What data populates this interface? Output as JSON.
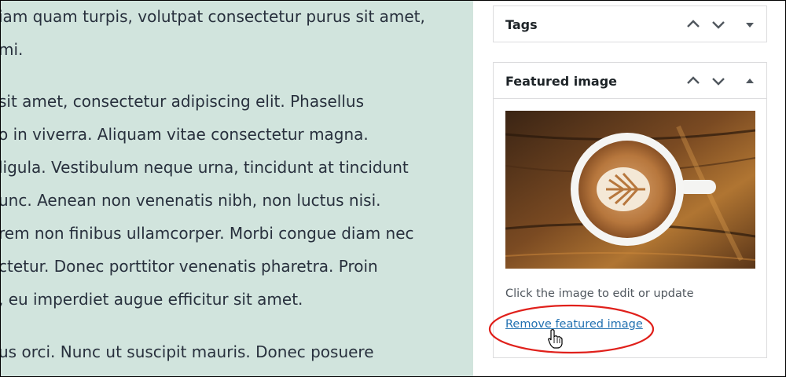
{
  "content": {
    "paragraphs": [
      {
        "lines": [
          "iam quam turpis, volutpat consectetur purus sit amet,",
          "mi."
        ]
      },
      {
        "lines": [
          "sit amet, consectetur adipiscing elit. Phasellus",
          "o in viverra. Aliquam vitae consectetur magna.",
          "ligula. Vestibulum neque urna, tincidunt at tincidunt",
          "unc. Aenean non venenatis nibh, non luctus nisi.",
          "rem non finibus ullamcorper. Morbi congue diam nec",
          "ctetur. Donec porttitor venenatis pharetra. Proin",
          ", eu imperdiet augue efficitur sit amet."
        ]
      },
      {
        "lines": [
          "us orci. Nunc ut suscipit mauris. Donec posuere"
        ]
      }
    ]
  },
  "sidebar": {
    "tags_panel": {
      "title": "Tags"
    },
    "featured_panel": {
      "title": "Featured image",
      "image_alt": "latte art coffee cup on wooden table",
      "hint": "Click the image to edit or update",
      "remove_label": "Remove featured image"
    }
  },
  "colors": {
    "content_bg": "#d1e4dd",
    "link": "#2271b1",
    "annotation": "#e0201b"
  }
}
